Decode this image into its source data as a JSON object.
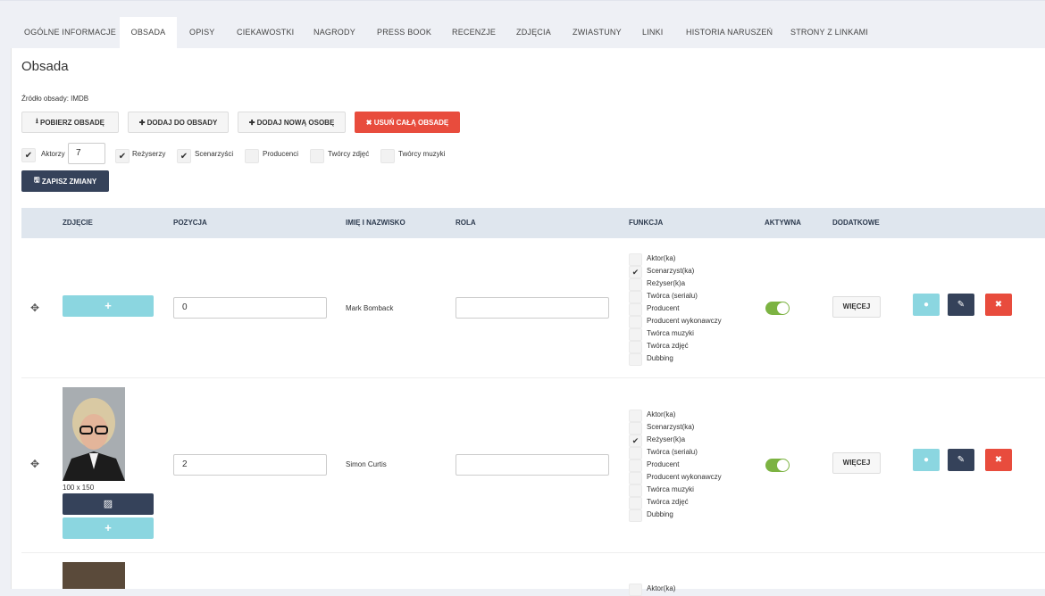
{
  "tabs": [
    "OGÓLNE INFORMACJE",
    "OBSADA",
    "OPISY",
    "CIEKAWOSTKI",
    "NAGRODY",
    "PRESS BOOK",
    "RECENZJE",
    "ZDJĘCIA",
    "ZWIASTUNY",
    "LINKI",
    "HISTORIA NARUSZEŃ",
    "STRONY Z LINKAMI"
  ],
  "page": {
    "title": "Obsada",
    "source": "Źródło obsady: IMDB"
  },
  "buttons": {
    "fetch": "POBIERZ OBSADĘ",
    "add_to_cast": "DODAJ DO OBSADY",
    "add_new_person": "DODAJ NOWĄ OSOBĘ",
    "remove_all": "USUŃ CAŁĄ OBSADĘ",
    "save": "ZAPISZ ZMIANY"
  },
  "filters": {
    "actors": "Aktorzy",
    "actors_count": "7",
    "directors": "Reżyserzy",
    "writers": "Scenarzyści",
    "producers": "Producenci",
    "cinematographers": "Twórcy zdjęć",
    "composers": "Twórcy muzyki"
  },
  "table": {
    "headers": [
      "ZDJĘCIE",
      "POZYCJA",
      "IMIĘ I NAZWISKO",
      "ROLA",
      "FUNKCJA",
      "AKTYWNA",
      "DODATKOWE"
    ],
    "functions": [
      "Aktor(ka)",
      "Scenarzyst(ka)",
      "Reżyser(k)a",
      "Twórca (serialu)",
      "Producent",
      "Producent wykonawczy",
      "Twórca muzyki",
      "Twórca zdjęć",
      "Dubbing"
    ],
    "more_label": "WIĘCEJ",
    "rows": [
      {
        "position": "0",
        "name": "Mark Bomback",
        "role": "",
        "checked_function": 1,
        "active": true
      },
      {
        "position": "2",
        "name": "Simon Curtis",
        "role": "",
        "checked_function": 2,
        "active": true,
        "photo_caption": "100 x 150"
      }
    ],
    "partial_function": "Aktor(ka)"
  },
  "colors": {
    "accent_dark": "#35425a",
    "danger": "#e84c3d",
    "info": "#8bd6e0",
    "success": "#7cb342"
  }
}
